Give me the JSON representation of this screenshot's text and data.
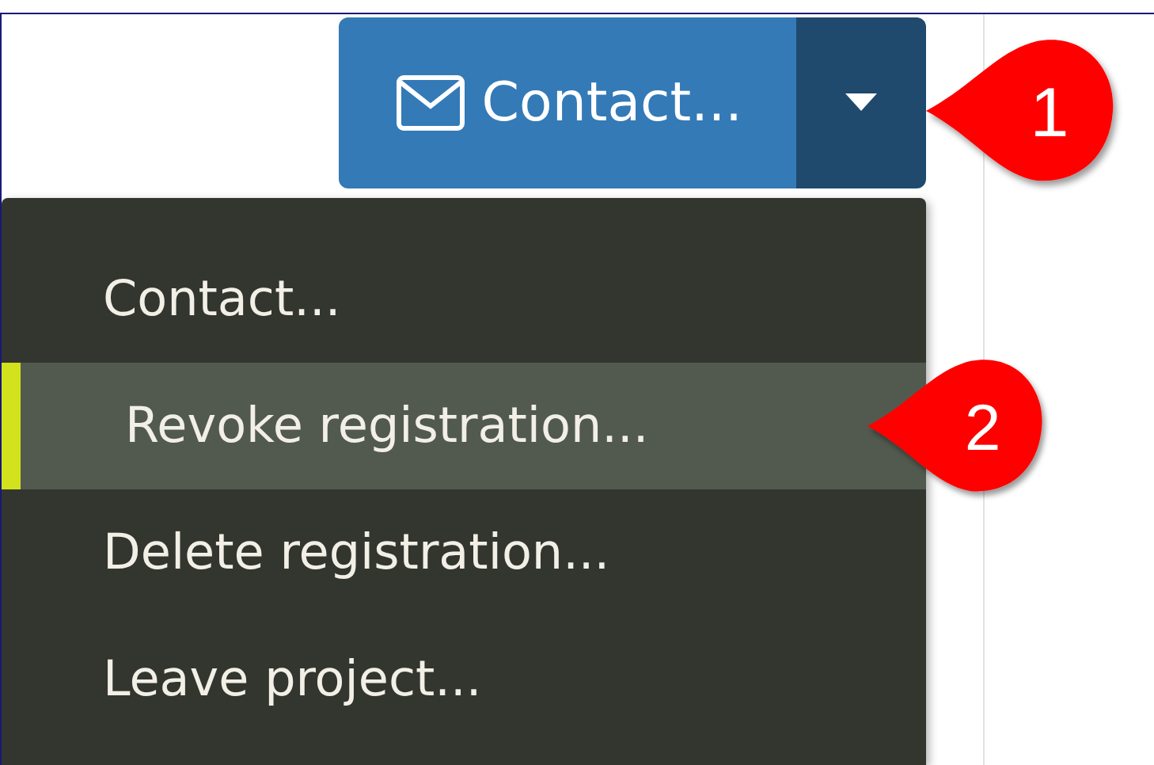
{
  "contact_button": {
    "label": "Contact..."
  },
  "menu": {
    "expanded": true,
    "items": [
      {
        "label": "Contact...",
        "selected": false
      },
      {
        "label": "Revoke registration...",
        "selected": true
      },
      {
        "label": "Delete registration...",
        "selected": false
      },
      {
        "label": "Leave project...",
        "selected": false
      }
    ]
  },
  "callouts": [
    {
      "label": "1"
    },
    {
      "label": "2"
    }
  ]
}
